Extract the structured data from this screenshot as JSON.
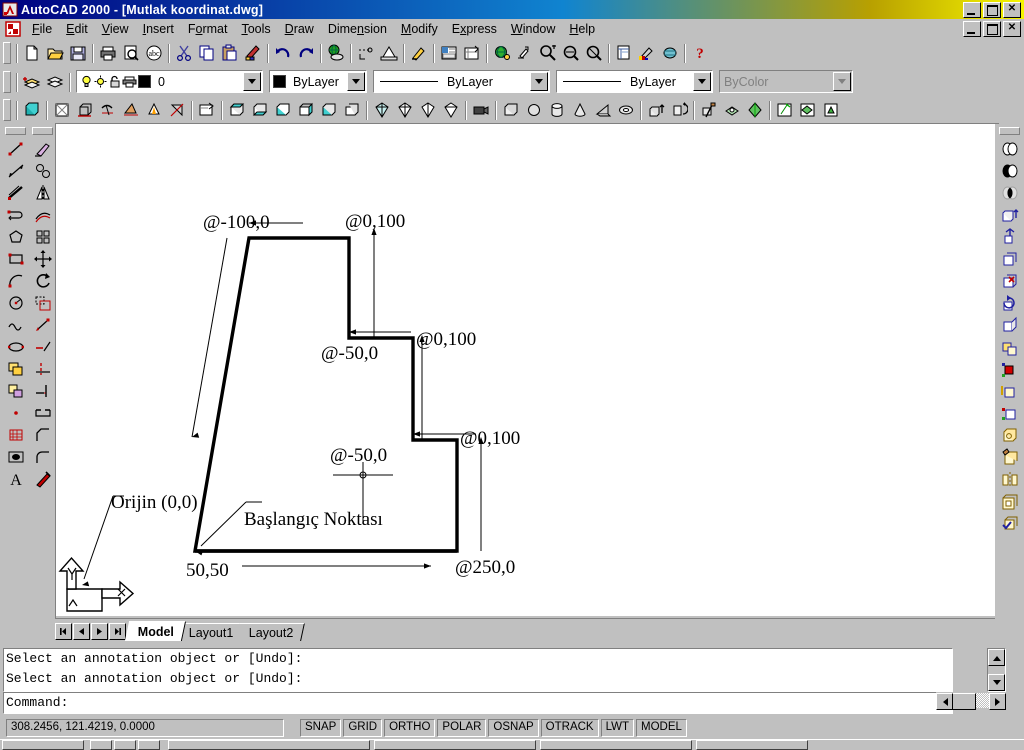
{
  "window": {
    "title": "AutoCAD 2000 - [Mutlak koordinat.dwg]",
    "app_icon": "autocad-logo-icon",
    "minimize_label": "_",
    "maximize_label": "□",
    "close_label": "✕"
  },
  "menu": {
    "items": [
      {
        "label": "File",
        "accel": "F"
      },
      {
        "label": "Edit",
        "accel": "E"
      },
      {
        "label": "View",
        "accel": "V"
      },
      {
        "label": "Insert",
        "accel": "I"
      },
      {
        "label": "Format",
        "accel": "o"
      },
      {
        "label": "Tools",
        "accel": "T"
      },
      {
        "label": "Draw",
        "accel": "D"
      },
      {
        "label": "Dimension",
        "accel": "n"
      },
      {
        "label": "Modify",
        "accel": "M"
      },
      {
        "label": "Express",
        "accel": "x"
      },
      {
        "label": "Window",
        "accel": "W"
      },
      {
        "label": "Help",
        "accel": "H"
      }
    ]
  },
  "standard_toolbar": {
    "buttons": [
      "new-icon",
      "open-icon",
      "save-icon",
      "print-icon",
      "print-preview-icon",
      "spell-check-icon",
      "cut-icon",
      "copy-icon",
      "paste-icon",
      "match-properties-icon",
      "undo-icon",
      "redo-icon",
      "launch-browser-icon",
      "distance-icon",
      "block-insert-icon",
      "select-objects-icon",
      "linetype-scale-icon",
      "properties-icon",
      "design-center-icon",
      "pan-realtime-icon",
      "zoom-realtime-icon",
      "zoom-window-icon",
      "zoom-previous-icon",
      "sheet-set-icon",
      "render-setup-icon",
      "ucs-globe-icon",
      "help-icon"
    ]
  },
  "properties_toolbar": {
    "make_object_layer_icon": "make-object-layer-icon",
    "layers_icon": "layers-dialog-icon",
    "layer": {
      "value": "0",
      "state_icons": [
        "lightbulb-on-icon",
        "sun-freeze-icon",
        "padlock-unlocked-icon",
        "printer-icon"
      ],
      "color_swatch": "#000000"
    },
    "color": {
      "value": "ByLayer",
      "swatch": "#000000"
    },
    "linetype": {
      "value": "ByLayer"
    },
    "lineweight": {
      "value": "ByLayer"
    },
    "plotstyle": {
      "value": "ByColor",
      "disabled": true
    }
  },
  "solids_toolbar": {
    "buttons": [
      "solids-3d-icon",
      "shade-2d-wireframe-icon",
      "shade-3d-wireframe-icon",
      "shade-hidden-icon",
      "shade-flat-icon",
      "shade-gouraud-icon",
      "shade-edges-icon",
      "named-views-icon",
      "view-top-icon",
      "view-bottom-icon",
      "view-left-icon",
      "view-right-icon",
      "view-front-icon",
      "view-back-icon",
      "view-sw-iso-icon",
      "view-se-iso-icon",
      "view-ne-iso-icon",
      "view-nw-iso-icon",
      "camera-icon",
      "box-icon",
      "sphere-icon",
      "cylinder-icon",
      "cone-icon",
      "wedge-icon",
      "torus-icon",
      "extrude-icon",
      "revolve-icon",
      "slice-icon",
      "section-icon",
      "interfere-icon",
      "setup-drawing-icon",
      "setup-view-icon",
      "setup-profile-icon"
    ]
  },
  "draw_toolbar": {
    "title": "Draw",
    "buttons": [
      "line-icon",
      "construction-line-icon",
      "polyline-icon",
      "multiline-icon",
      "polygon-icon",
      "rectangle-icon",
      "arc-icon",
      "circle-icon",
      "spline-icon",
      "ellipse-icon",
      "insert-block-icon",
      "make-block-icon",
      "point-icon",
      "hatch-icon",
      "region-icon",
      "multiline-text-icon"
    ]
  },
  "modify_toolbar": {
    "title": "Modify",
    "buttons": [
      "erase-icon",
      "copy-object-icon",
      "mirror-icon",
      "offset-icon",
      "array-icon",
      "move-icon",
      "rotate-icon",
      "scale-icon",
      "stretch-icon",
      "lengthen-icon",
      "trim-icon",
      "extend-icon",
      "break-icon",
      "chamfer-icon",
      "fillet-icon",
      "explode-icon"
    ]
  },
  "solids_editing_toolbar": {
    "title": "Solids Editing",
    "buttons": [
      "union-icon",
      "subtract-icon",
      "intersect-icon",
      "extrude-faces-icon",
      "move-faces-icon",
      "offset-faces-icon",
      "delete-faces-icon",
      "rotate-faces-icon",
      "taper-faces-icon",
      "copy-faces-icon",
      "color-faces-icon",
      "copy-edges-icon",
      "color-edges-icon",
      "imprint-icon",
      "clean-icon",
      "separate-icon",
      "shell-icon",
      "check-icon"
    ]
  },
  "drawing": {
    "ucs_icon": {
      "x_label": "X",
      "y_label": "Y"
    },
    "annotations": [
      {
        "id": "label-top-left",
        "text": "@-100,0"
      },
      {
        "id": "label-top-right",
        "text": "@0,100"
      },
      {
        "id": "label-mid-left",
        "text": "@-50,0"
      },
      {
        "id": "label-mid-right",
        "text": "@0,100"
      },
      {
        "id": "label-lower-right",
        "text": "@0,100"
      },
      {
        "id": "label-center",
        "text": "@-50,0"
      },
      {
        "id": "label-bottom-right",
        "text": "@250,0"
      },
      {
        "id": "label-origin",
        "text": "Orijin (0,0)"
      },
      {
        "id": "label-start-point",
        "text": "Başlangıç Noktası"
      },
      {
        "id": "label-start-coord",
        "text": "50,50"
      }
    ],
    "shape_color": "#000000",
    "background": "#ffffff"
  },
  "layout_tabs": {
    "nav": [
      "first-tab-icon",
      "prev-tab-icon",
      "next-tab-icon",
      "last-tab-icon"
    ],
    "tabs": [
      {
        "label": "Model",
        "active": true
      },
      {
        "label": "Layout1",
        "active": false
      },
      {
        "label": "Layout2",
        "active": false
      }
    ]
  },
  "command_window": {
    "history": "Select an annotation object or [Undo]:\nSelect an annotation object or [Undo]:",
    "prompt": "Command:",
    "scroll_up_icon": "scroll-up-icon",
    "scroll_down_icon": "scroll-down-icon",
    "scroll_left_icon": "scroll-left-icon",
    "scroll_right_icon": "scroll-right-icon"
  },
  "status_bar": {
    "coordinates": "308.2456, 121.4219, 0.0000",
    "toggles": [
      {
        "label": "SNAP",
        "pressed": false
      },
      {
        "label": "GRID",
        "pressed": false
      },
      {
        "label": "ORTHO",
        "pressed": false
      },
      {
        "label": "POLAR",
        "pressed": false
      },
      {
        "label": "OSNAP",
        "pressed": false
      },
      {
        "label": "OTRACK",
        "pressed": false
      },
      {
        "label": "LWT",
        "pressed": false
      },
      {
        "label": "MODEL",
        "pressed": false
      }
    ]
  }
}
